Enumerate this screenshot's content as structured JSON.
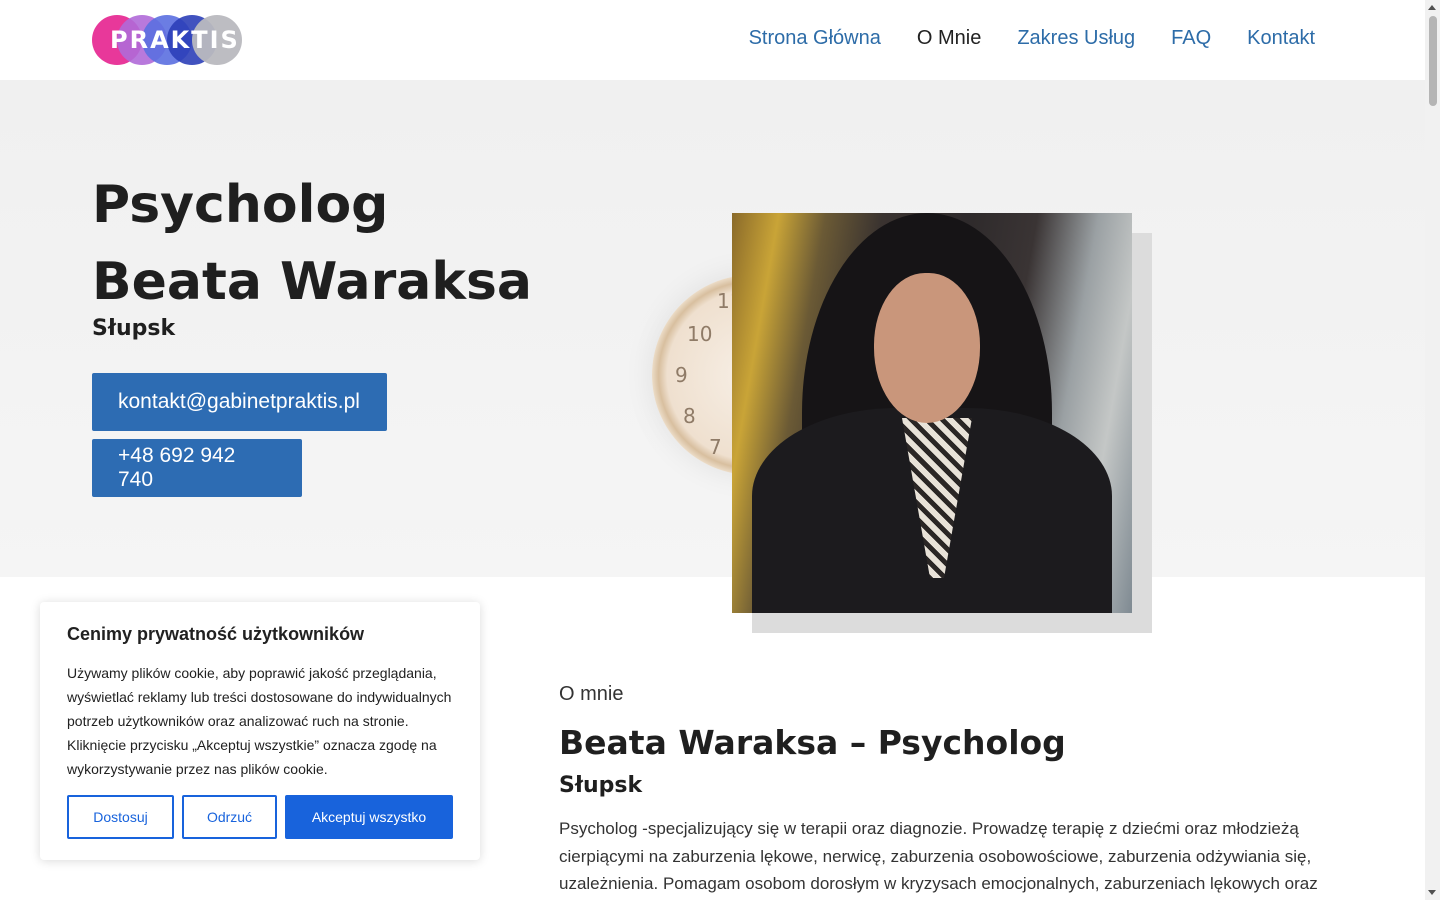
{
  "header": {
    "logo_text": "PRAKTIS",
    "nav": [
      {
        "label": "Strona Główna"
      },
      {
        "label": "O Mnie"
      },
      {
        "label": "Zakres Usług"
      },
      {
        "label": "FAQ"
      },
      {
        "label": "Kontakt"
      }
    ]
  },
  "hero": {
    "title_line1": "Psycholog",
    "title_line2": "Beata Waraksa",
    "city": "Słupsk",
    "email_button": "kontakt@gabinetpraktis.pl",
    "phone_button": "+48 692 942 740",
    "clock_numbers": [
      "11",
      "10",
      "9",
      "8",
      "7"
    ]
  },
  "about": {
    "eyebrow": "O mnie",
    "title": "Beata Waraksa – Psycholog",
    "city": "Słupsk",
    "text": "Psycholog -specjalizujący się w terapii oraz diagnozie. Prowadzę terapię z dziećmi oraz młodzieżą cierpiącymi na zaburzenia lękowe, nerwicę, zaburzenia osobowościowe, zaburzenia odżywiania się, uzależnienia. Pomagam osobom dorosłym w kryzysach emocjonalnych, zaburzeniach lękowych oraz"
  },
  "cookie": {
    "title": "Cenimy prywatność użytkowników",
    "text": "Używamy plików cookie, aby poprawić jakość przeglądania, wyświetlać reklamy lub treści dostosowane do indywidualnych potrzeb użytkowników oraz analizować ruch na stronie. Kliknięcie przycisku „Akceptuj wszystkie” oznacza zgodę na wykorzystywanie przez nas plików cookie.",
    "customize": "Dostosuj",
    "reject": "Odrzuć",
    "accept": "Akceptuj wszystko"
  },
  "colors": {
    "link": "#2d6ca8",
    "primary_button": "#2d6cb3",
    "cookie_accent": "#1863dc"
  }
}
